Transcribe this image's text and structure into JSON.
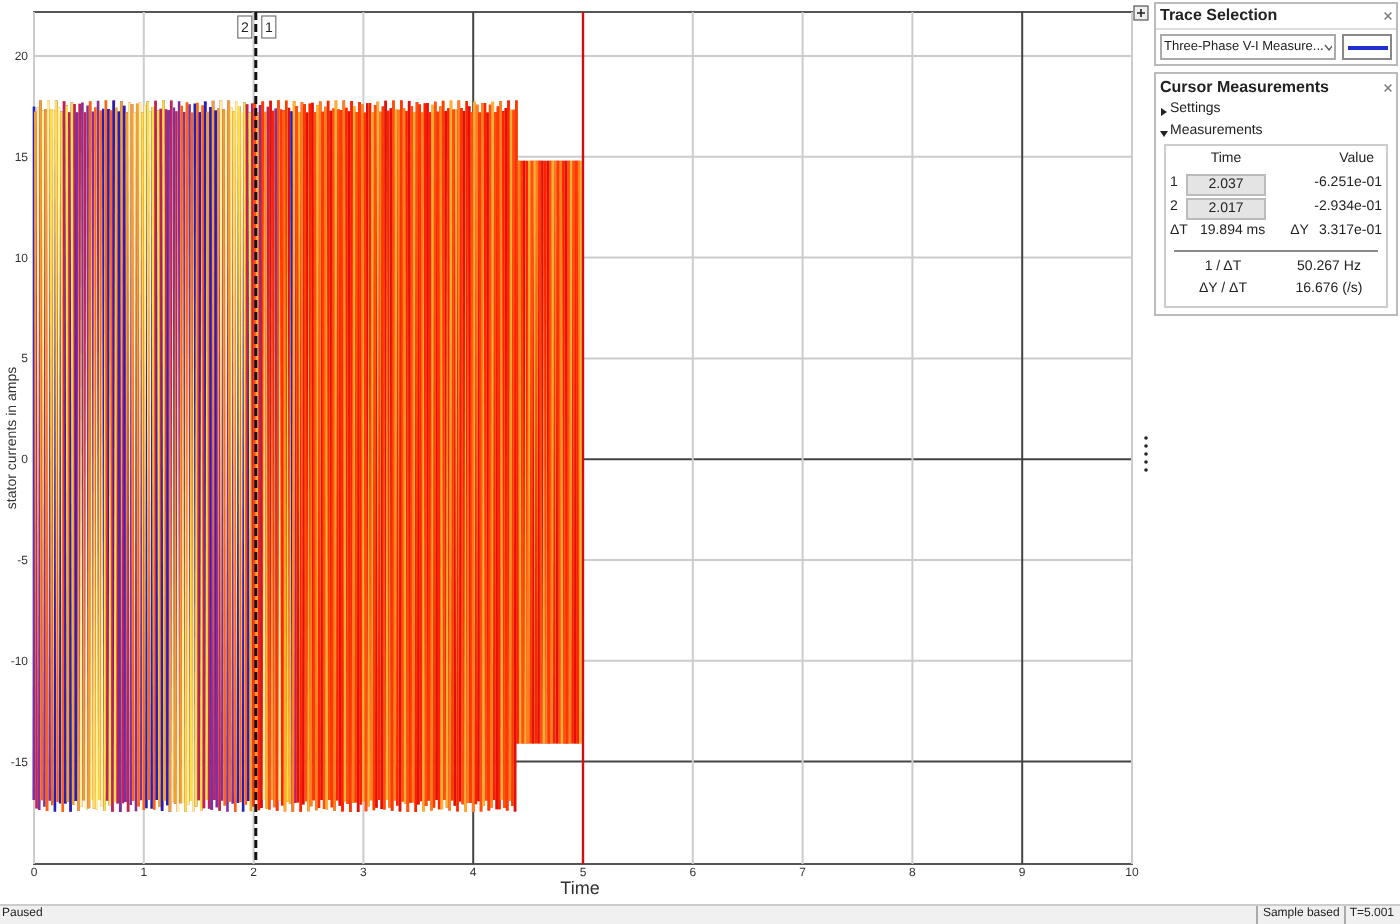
{
  "plot": {
    "y_label": "stator currents in amps",
    "x_label": "Time",
    "y_ticks": [
      "20",
      "15",
      "10",
      "5",
      "0",
      "-5",
      "-10",
      "-15"
    ],
    "x_ticks": [
      "0",
      "1",
      "2",
      "3",
      "4",
      "5",
      "6",
      "7",
      "8",
      "9",
      "10"
    ],
    "cursor_labels": [
      "2",
      "1"
    ]
  },
  "trace_selection": {
    "title": "Trace Selection",
    "trace": "Three-Phase V-I Measure..."
  },
  "cursor_measurements": {
    "title": "Cursor Measurements",
    "sections": [
      {
        "label": "Settings",
        "expanded": false
      },
      {
        "label": "Measurements",
        "expanded": true
      }
    ],
    "headers": [
      "Time",
      "Value"
    ],
    "rows": [
      {
        "label": "1",
        "time": "2.037",
        "value": "-6.251e-01"
      },
      {
        "label": "2",
        "time": "2.017",
        "value": "-2.934e-01"
      }
    ],
    "delta": {
      "dt_label": "ΔT",
      "dt": "19.894 ms",
      "dy_label": "ΔY",
      "dy": "3.317e-01"
    },
    "derived": [
      {
        "label": "1 / ΔT",
        "value": "50.267 Hz"
      },
      {
        "label": "ΔY / ΔT",
        "value": "16.676 (/s)"
      }
    ]
  },
  "status_bar": {
    "left": "Paused",
    "right": [
      "Sample based",
      "T=5.001"
    ]
  }
}
